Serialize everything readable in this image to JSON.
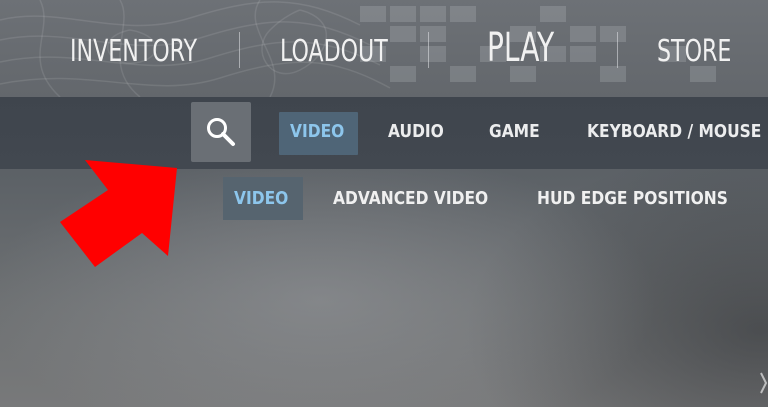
{
  "top_nav": {
    "items": [
      {
        "label": "INVENTORY"
      },
      {
        "label": "LOADOUT"
      },
      {
        "label": "PLAY"
      },
      {
        "label": "STORE"
      }
    ]
  },
  "settings_tabs": {
    "search_icon": "search-icon",
    "items": [
      {
        "label": "VIDEO",
        "active": true
      },
      {
        "label": "AUDIO",
        "active": false
      },
      {
        "label": "GAME",
        "active": false
      },
      {
        "label": "KEYBOARD / MOUSE",
        "active": false
      }
    ]
  },
  "sub_tabs": {
    "items": [
      {
        "label": "VIDEO",
        "active": true
      },
      {
        "label": "ADVANCED VIDEO",
        "active": false
      },
      {
        "label": "HUD EDGE POSITIONS",
        "active": false
      }
    ]
  },
  "annotation": {
    "icon": "red-arrow-icon",
    "color": "#ff0000"
  },
  "colors": {
    "active_tab_text": "#8dc6ec",
    "active_tab_bg": "#4f6577",
    "tab_bar_bg": "#3f454d",
    "nav_text": "#f1f1f1"
  }
}
